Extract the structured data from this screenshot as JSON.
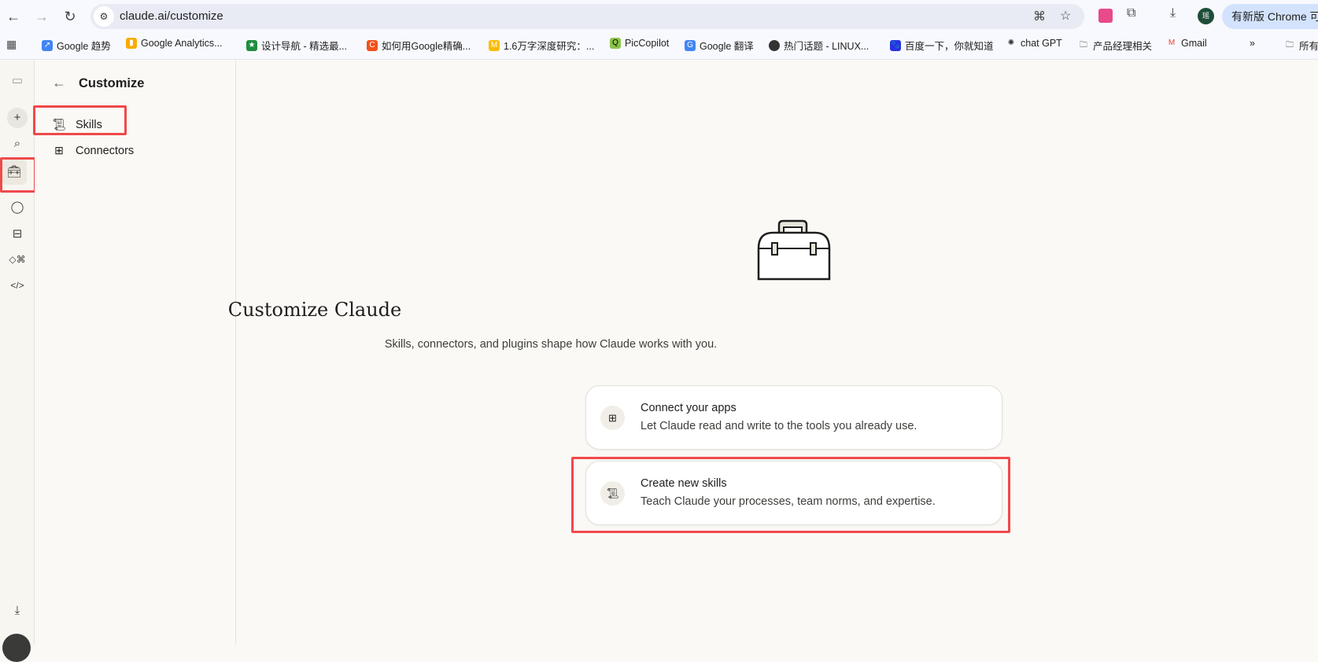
{
  "browser": {
    "url": "claude.ai/customize",
    "update_label": "有新版 Chrome 可用",
    "avatar_initial": "瑶",
    "bookmarks": [
      "Google 趋势",
      "Google Analytics...",
      "设计导航 - 精选最...",
      "如何用Google精确...",
      "1.6万字深度研究：...",
      "PicCopilot",
      "Google 翻译",
      "热门话题 - LINUX...",
      "百度一下，你就知道",
      "chat GPT",
      "产品经理相关",
      "Gmail"
    ],
    "bookmarks_more": "»",
    "bookmarks_all": "所有书签"
  },
  "panel": {
    "title": "Customize",
    "items": [
      {
        "label": "Skills",
        "icon": "scroll-icon"
      },
      {
        "label": "Connectors",
        "icon": "connectors-icon"
      }
    ]
  },
  "main": {
    "title": "Customize Claude",
    "subtitle": "Skills, connectors, and plugins shape how Claude works with you.",
    "cards": [
      {
        "title": "Connect your apps",
        "desc": "Let Claude read and write to the tools you already use.",
        "icon": "connectors-icon"
      },
      {
        "title": "Create new skills",
        "desc": "Teach Claude your processes, team norms, and expertise.",
        "icon": "scroll-icon"
      }
    ]
  },
  "colors": {
    "highlight": "#f0494b",
    "background": "#faf9f5"
  }
}
